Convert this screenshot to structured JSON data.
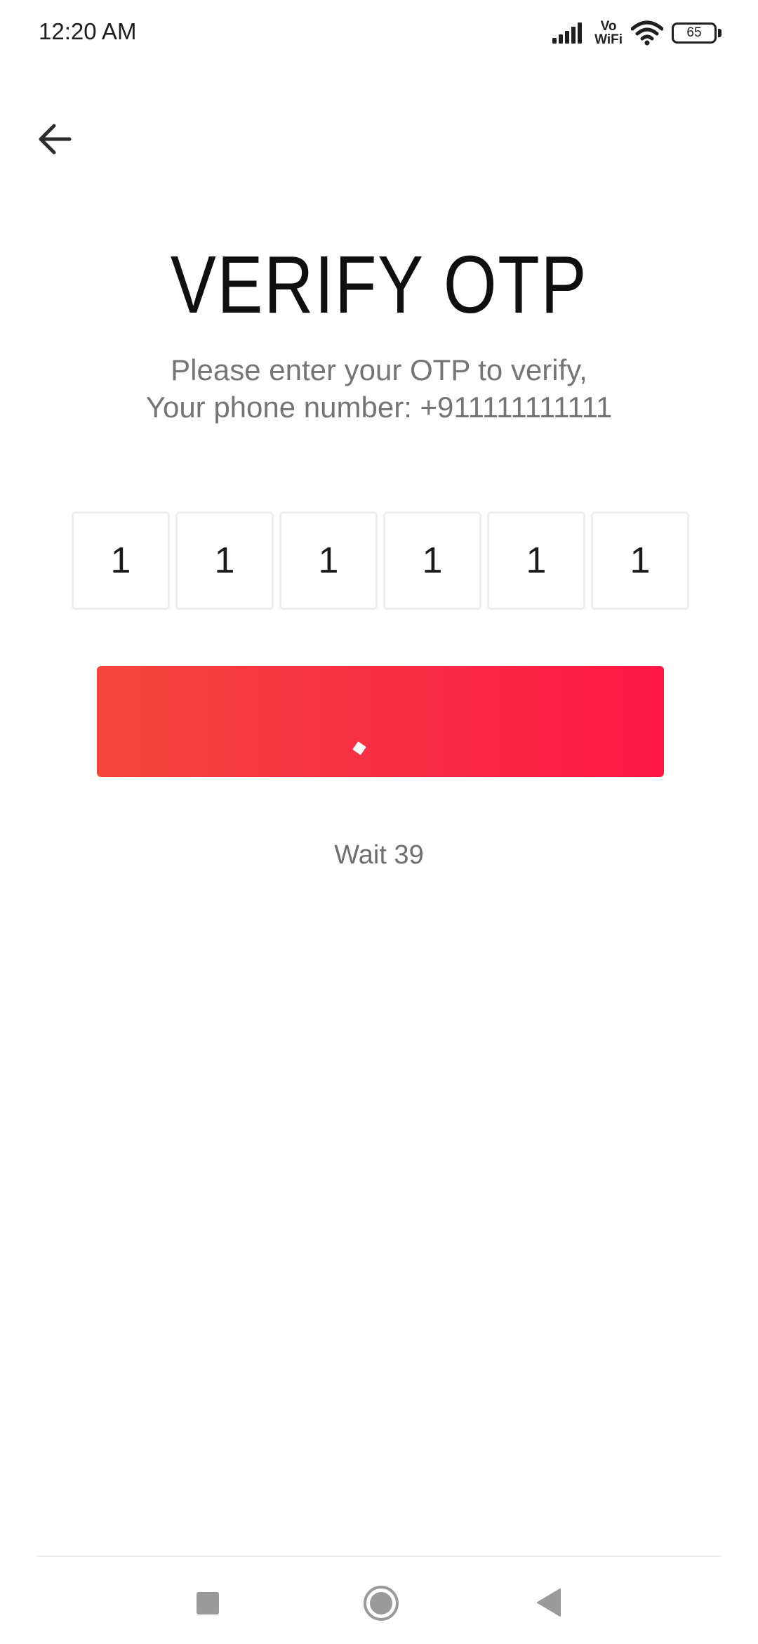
{
  "status_bar": {
    "time": "12:20 AM",
    "volte_top": "Vo",
    "volte_bottom": "WiFi",
    "battery_level": "65",
    "icons": [
      "signal-icon",
      "vowifi-icon",
      "wifi-icon",
      "battery-icon"
    ]
  },
  "header": {
    "back_icon": "arrow-left-icon"
  },
  "main": {
    "title": "VERIFY OTP",
    "subtitle_line1": "Please enter your OTP to verify,",
    "subtitle_line2": "Your phone number: +911111111111",
    "otp_digits": [
      "1",
      "1",
      "1",
      "1",
      "1",
      "1"
    ],
    "verify_button_state": "loading",
    "wait_text": "Wait 39"
  },
  "colors": {
    "button_gradient_start": "#f4473a",
    "button_gradient_end": "#ff1744",
    "subtitle_text": "#757575",
    "otp_border": "#eeeeee"
  },
  "nav_bar": {
    "items": [
      "recent-apps-icon",
      "home-icon",
      "back-triangle-icon"
    ]
  }
}
